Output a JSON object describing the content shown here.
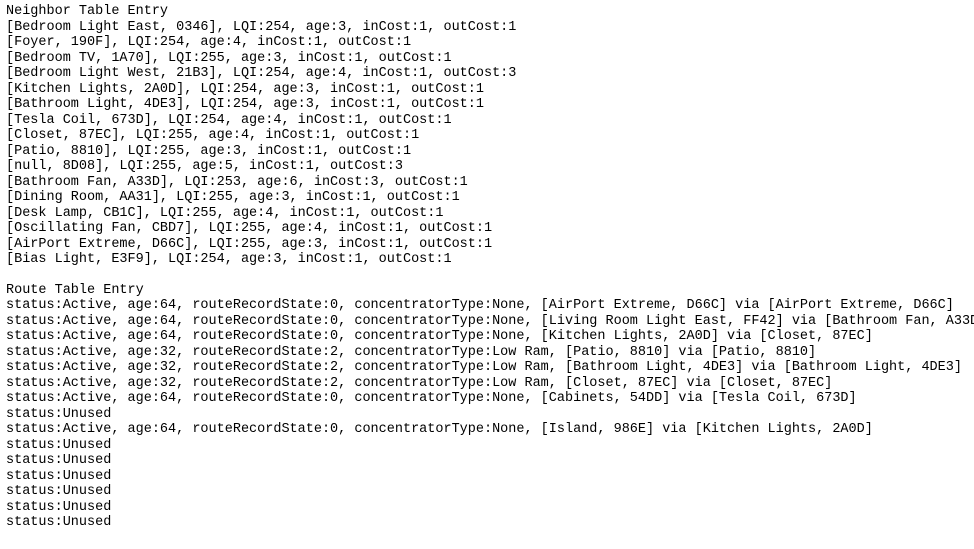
{
  "neighborHeader": "Neighbor Table Entry",
  "neighbors": [
    {
      "name": "Bedroom Light East",
      "id": "0346",
      "lqi": 254,
      "age": 3,
      "inCost": 1,
      "outCost": 1
    },
    {
      "name": "Foyer",
      "id": "190F",
      "lqi": 254,
      "age": 4,
      "inCost": 1,
      "outCost": 1
    },
    {
      "name": "Bedroom TV",
      "id": "1A70",
      "lqi": 255,
      "age": 3,
      "inCost": 1,
      "outCost": 1
    },
    {
      "name": "Bedroom Light West",
      "id": "21B3",
      "lqi": 254,
      "age": 4,
      "inCost": 1,
      "outCost": 3
    },
    {
      "name": "Kitchen Lights",
      "id": "2A0D",
      "lqi": 254,
      "age": 3,
      "inCost": 1,
      "outCost": 1
    },
    {
      "name": "Bathroom Light",
      "id": "4DE3",
      "lqi": 254,
      "age": 3,
      "inCost": 1,
      "outCost": 1
    },
    {
      "name": "Tesla Coil",
      "id": "673D",
      "lqi": 254,
      "age": 4,
      "inCost": 1,
      "outCost": 1
    },
    {
      "name": "Closet",
      "id": "87EC",
      "lqi": 255,
      "age": 4,
      "inCost": 1,
      "outCost": 1
    },
    {
      "name": "Patio",
      "id": "8810",
      "lqi": 255,
      "age": 3,
      "inCost": 1,
      "outCost": 1
    },
    {
      "name": "null",
      "id": "8D08",
      "lqi": 255,
      "age": 5,
      "inCost": 1,
      "outCost": 3
    },
    {
      "name": "Bathroom Fan",
      "id": "A33D",
      "lqi": 253,
      "age": 6,
      "inCost": 3,
      "outCost": 1
    },
    {
      "name": "Dining Room",
      "id": "AA31",
      "lqi": 255,
      "age": 3,
      "inCost": 1,
      "outCost": 1
    },
    {
      "name": "Desk Lamp",
      "id": "CB1C",
      "lqi": 255,
      "age": 4,
      "inCost": 1,
      "outCost": 1
    },
    {
      "name": "Oscillating Fan",
      "id": "CBD7",
      "lqi": 255,
      "age": 4,
      "inCost": 1,
      "outCost": 1
    },
    {
      "name": "AirPort Extreme",
      "id": "D66C",
      "lqi": 255,
      "age": 3,
      "inCost": 1,
      "outCost": 1
    },
    {
      "name": "Bias Light",
      "id": "E3F9",
      "lqi": 254,
      "age": 3,
      "inCost": 1,
      "outCost": 1
    }
  ],
  "routeHeader": "Route Table Entry",
  "routes": [
    {
      "status": "Active",
      "age": 64,
      "routeRecordState": 0,
      "concentratorType": "None",
      "dest": {
        "name": "AirPort Extreme",
        "id": "D66C"
      },
      "via": {
        "name": "AirPort Extreme",
        "id": "D66C"
      }
    },
    {
      "status": "Active",
      "age": 64,
      "routeRecordState": 0,
      "concentratorType": "None",
      "dest": {
        "name": "Living Room Light East",
        "id": "FF42"
      },
      "via": {
        "name": "Bathroom Fan",
        "id": "A33D"
      }
    },
    {
      "status": "Active",
      "age": 64,
      "routeRecordState": 0,
      "concentratorType": "None",
      "dest": {
        "name": "Kitchen Lights",
        "id": "2A0D"
      },
      "via": {
        "name": "Closet",
        "id": "87EC"
      }
    },
    {
      "status": "Active",
      "age": 32,
      "routeRecordState": 2,
      "concentratorType": "Low Ram",
      "dest": {
        "name": "Patio",
        "id": "8810"
      },
      "via": {
        "name": "Patio",
        "id": "8810"
      }
    },
    {
      "status": "Active",
      "age": 32,
      "routeRecordState": 2,
      "concentratorType": "Low Ram",
      "dest": {
        "name": "Bathroom Light",
        "id": "4DE3"
      },
      "via": {
        "name": "Bathroom Light",
        "id": "4DE3"
      }
    },
    {
      "status": "Active",
      "age": 32,
      "routeRecordState": 2,
      "concentratorType": "Low Ram",
      "dest": {
        "name": "Closet",
        "id": "87EC"
      },
      "via": {
        "name": "Closet",
        "id": "87EC"
      }
    },
    {
      "status": "Active",
      "age": 64,
      "routeRecordState": 0,
      "concentratorType": "None",
      "dest": {
        "name": "Cabinets",
        "id": "54DD"
      },
      "via": {
        "name": "Tesla Coil",
        "id": "673D"
      }
    },
    {
      "status": "Unused"
    },
    {
      "status": "Active",
      "age": 64,
      "routeRecordState": 0,
      "concentratorType": "None",
      "dest": {
        "name": "Island",
        "id": "986E"
      },
      "via": {
        "name": "Kitchen Lights",
        "id": "2A0D"
      }
    },
    {
      "status": "Unused"
    },
    {
      "status": "Unused"
    },
    {
      "status": "Unused"
    },
    {
      "status": "Unused"
    },
    {
      "status": "Unused"
    },
    {
      "status": "Unused"
    }
  ]
}
